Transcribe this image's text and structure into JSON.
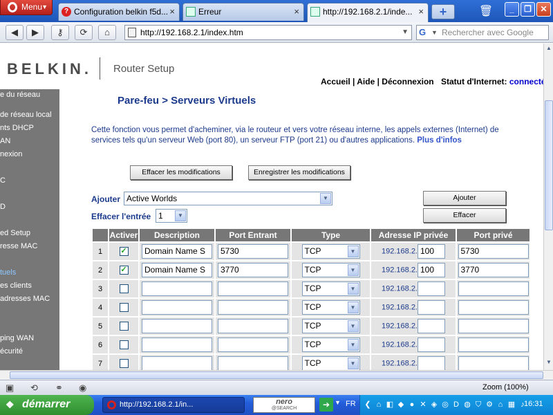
{
  "browser": {
    "menu_label": "Menu",
    "tabs": [
      {
        "title": "Configuration belkin f5d..."
      },
      {
        "title": "Erreur"
      },
      {
        "title": "http://192.168.2.1/inde..."
      }
    ],
    "close_glyph": "×",
    "new_tab_glyph": "+",
    "url": "http://192.168.2.1/index.htm",
    "search_placeholder": "Rechercher avec Google",
    "nav_glyphs": {
      "back": "◀",
      "forward": "▶",
      "key": "⚷",
      "reload": "⟳",
      "home": "⌂"
    },
    "window_glyphs": {
      "minimize": "_",
      "maximize": "❐",
      "close": "✕"
    },
    "zoom": "Zoom (100%)"
  },
  "header": {
    "logo": "BELKIN.",
    "subtitle": "Router Setup",
    "links": "Accueil | Aide | Déconnexion",
    "status_label": "Statut d'Internet:",
    "status_value": "connecté"
  },
  "sidebar": {
    "items": [
      {
        "label": "e du réseau",
        "active": false
      },
      {
        "label": "de réseau local",
        "active": false
      },
      {
        "label": "nts DHCP",
        "active": false
      },
      {
        "label": "AN",
        "active": false
      },
      {
        "label": "nexion",
        "active": false
      },
      {
        "label": "C",
        "active": false
      },
      {
        "label": "D",
        "active": false
      },
      {
        "label": "ed Setup",
        "active": false
      },
      {
        "label": "resse MAC",
        "active": false
      },
      {
        "label": "tuels",
        "active": true
      },
      {
        "label": "es clients",
        "active": false
      },
      {
        "label": "adresses MAC",
        "active": false
      },
      {
        "label": "ping WAN",
        "active": false
      },
      {
        "label": "écurité",
        "active": false
      }
    ]
  },
  "content": {
    "title": "Pare-feu > Serveurs Virtuels",
    "description": "Cette fonction vous permet d'acheminer, via le routeur et vers votre réseau interne, les appels externes (Internet) de services tels qu'un serveur Web (port 80), un serveur FTP (port 21) ou d'autres applications.",
    "more_link": "Plus d'infos",
    "clear_button": "Effacer les modifications",
    "save_button": "Enregistrer les modifications",
    "add_label": "Ajouter",
    "add_select_value": "Active Worlds",
    "add_button": "Ajouter",
    "clear_entry_label": "Effacer l'entrée",
    "clear_entry_value": "1",
    "clear_entry_button": "Effacer",
    "table": {
      "headers": [
        "",
        "Activer",
        "Description",
        "Port Entrant",
        "Type",
        "Adresse IP privée",
        "Port privé"
      ],
      "ip_prefix": "192.168.2.",
      "rows": [
        {
          "num": "1",
          "enabled": true,
          "description": "Domain Name S",
          "port_in": "5730",
          "type": "TCP",
          "ip": "100",
          "port_priv": "5730"
        },
        {
          "num": "2",
          "enabled": true,
          "description": "Domain Name S",
          "port_in": "3770",
          "type": "TCP",
          "ip": "100",
          "port_priv": "3770"
        },
        {
          "num": "3",
          "enabled": false,
          "description": "",
          "port_in": "",
          "type": "TCP",
          "ip": "",
          "port_priv": ""
        },
        {
          "num": "4",
          "enabled": false,
          "description": "",
          "port_in": "",
          "type": "TCP",
          "ip": "",
          "port_priv": ""
        },
        {
          "num": "5",
          "enabled": false,
          "description": "",
          "port_in": "",
          "type": "TCP",
          "ip": "",
          "port_priv": ""
        },
        {
          "num": "6",
          "enabled": false,
          "description": "",
          "port_in": "",
          "type": "TCP",
          "ip": "",
          "port_priv": ""
        },
        {
          "num": "7",
          "enabled": false,
          "description": "",
          "port_in": "",
          "type": "TCP",
          "ip": "",
          "port_priv": ""
        }
      ]
    }
  },
  "taskbar": {
    "start_label": "démarrer",
    "task_item": "http://192.168.2.1/in...",
    "nero_line1": "nero",
    "nero_line2": "@SEARCH",
    "language": "FR",
    "clock": "16:31"
  },
  "icons": {
    "opera": "opera-icon",
    "dropdown_arrow": "▼",
    "windows_flag": "❖"
  }
}
